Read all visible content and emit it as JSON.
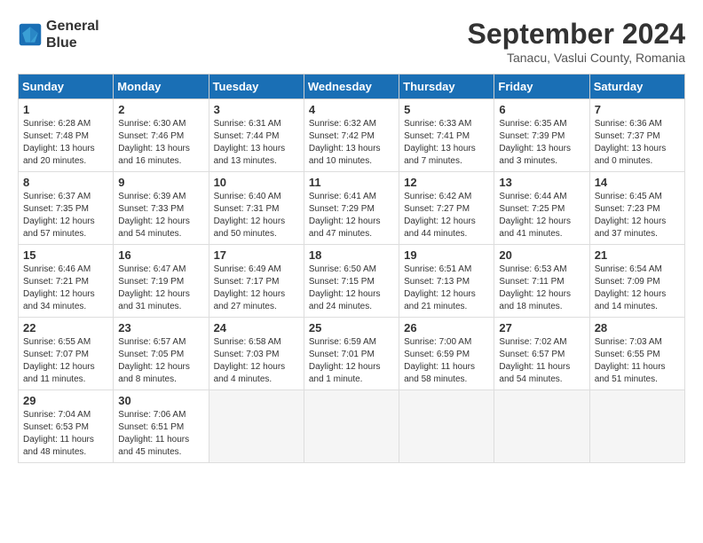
{
  "header": {
    "logo_line1": "General",
    "logo_line2": "Blue",
    "month": "September 2024",
    "location": "Tanacu, Vaslui County, Romania"
  },
  "weekdays": [
    "Sunday",
    "Monday",
    "Tuesday",
    "Wednesday",
    "Thursday",
    "Friday",
    "Saturday"
  ],
  "weeks": [
    [
      {
        "day": "1",
        "sunrise": "Sunrise: 6:28 AM",
        "sunset": "Sunset: 7:48 PM",
        "daylight": "Daylight: 13 hours and 20 minutes."
      },
      {
        "day": "2",
        "sunrise": "Sunrise: 6:30 AM",
        "sunset": "Sunset: 7:46 PM",
        "daylight": "Daylight: 13 hours and 16 minutes."
      },
      {
        "day": "3",
        "sunrise": "Sunrise: 6:31 AM",
        "sunset": "Sunset: 7:44 PM",
        "daylight": "Daylight: 13 hours and 13 minutes."
      },
      {
        "day": "4",
        "sunrise": "Sunrise: 6:32 AM",
        "sunset": "Sunset: 7:42 PM",
        "daylight": "Daylight: 13 hours and 10 minutes."
      },
      {
        "day": "5",
        "sunrise": "Sunrise: 6:33 AM",
        "sunset": "Sunset: 7:41 PM",
        "daylight": "Daylight: 13 hours and 7 minutes."
      },
      {
        "day": "6",
        "sunrise": "Sunrise: 6:35 AM",
        "sunset": "Sunset: 7:39 PM",
        "daylight": "Daylight: 13 hours and 3 minutes."
      },
      {
        "day": "7",
        "sunrise": "Sunrise: 6:36 AM",
        "sunset": "Sunset: 7:37 PM",
        "daylight": "Daylight: 13 hours and 0 minutes."
      }
    ],
    [
      {
        "day": "8",
        "sunrise": "Sunrise: 6:37 AM",
        "sunset": "Sunset: 7:35 PM",
        "daylight": "Daylight: 12 hours and 57 minutes."
      },
      {
        "day": "9",
        "sunrise": "Sunrise: 6:39 AM",
        "sunset": "Sunset: 7:33 PM",
        "daylight": "Daylight: 12 hours and 54 minutes."
      },
      {
        "day": "10",
        "sunrise": "Sunrise: 6:40 AM",
        "sunset": "Sunset: 7:31 PM",
        "daylight": "Daylight: 12 hours and 50 minutes."
      },
      {
        "day": "11",
        "sunrise": "Sunrise: 6:41 AM",
        "sunset": "Sunset: 7:29 PM",
        "daylight": "Daylight: 12 hours and 47 minutes."
      },
      {
        "day": "12",
        "sunrise": "Sunrise: 6:42 AM",
        "sunset": "Sunset: 7:27 PM",
        "daylight": "Daylight: 12 hours and 44 minutes."
      },
      {
        "day": "13",
        "sunrise": "Sunrise: 6:44 AM",
        "sunset": "Sunset: 7:25 PM",
        "daylight": "Daylight: 12 hours and 41 minutes."
      },
      {
        "day": "14",
        "sunrise": "Sunrise: 6:45 AM",
        "sunset": "Sunset: 7:23 PM",
        "daylight": "Daylight: 12 hours and 37 minutes."
      }
    ],
    [
      {
        "day": "15",
        "sunrise": "Sunrise: 6:46 AM",
        "sunset": "Sunset: 7:21 PM",
        "daylight": "Daylight: 12 hours and 34 minutes."
      },
      {
        "day": "16",
        "sunrise": "Sunrise: 6:47 AM",
        "sunset": "Sunset: 7:19 PM",
        "daylight": "Daylight: 12 hours and 31 minutes."
      },
      {
        "day": "17",
        "sunrise": "Sunrise: 6:49 AM",
        "sunset": "Sunset: 7:17 PM",
        "daylight": "Daylight: 12 hours and 27 minutes."
      },
      {
        "day": "18",
        "sunrise": "Sunrise: 6:50 AM",
        "sunset": "Sunset: 7:15 PM",
        "daylight": "Daylight: 12 hours and 24 minutes."
      },
      {
        "day": "19",
        "sunrise": "Sunrise: 6:51 AM",
        "sunset": "Sunset: 7:13 PM",
        "daylight": "Daylight: 12 hours and 21 minutes."
      },
      {
        "day": "20",
        "sunrise": "Sunrise: 6:53 AM",
        "sunset": "Sunset: 7:11 PM",
        "daylight": "Daylight: 12 hours and 18 minutes."
      },
      {
        "day": "21",
        "sunrise": "Sunrise: 6:54 AM",
        "sunset": "Sunset: 7:09 PM",
        "daylight": "Daylight: 12 hours and 14 minutes."
      }
    ],
    [
      {
        "day": "22",
        "sunrise": "Sunrise: 6:55 AM",
        "sunset": "Sunset: 7:07 PM",
        "daylight": "Daylight: 12 hours and 11 minutes."
      },
      {
        "day": "23",
        "sunrise": "Sunrise: 6:57 AM",
        "sunset": "Sunset: 7:05 PM",
        "daylight": "Daylight: 12 hours and 8 minutes."
      },
      {
        "day": "24",
        "sunrise": "Sunrise: 6:58 AM",
        "sunset": "Sunset: 7:03 PM",
        "daylight": "Daylight: 12 hours and 4 minutes."
      },
      {
        "day": "25",
        "sunrise": "Sunrise: 6:59 AM",
        "sunset": "Sunset: 7:01 PM",
        "daylight": "Daylight: 12 hours and 1 minute."
      },
      {
        "day": "26",
        "sunrise": "Sunrise: 7:00 AM",
        "sunset": "Sunset: 6:59 PM",
        "daylight": "Daylight: 11 hours and 58 minutes."
      },
      {
        "day": "27",
        "sunrise": "Sunrise: 7:02 AM",
        "sunset": "Sunset: 6:57 PM",
        "daylight": "Daylight: 11 hours and 54 minutes."
      },
      {
        "day": "28",
        "sunrise": "Sunrise: 7:03 AM",
        "sunset": "Sunset: 6:55 PM",
        "daylight": "Daylight: 11 hours and 51 minutes."
      }
    ],
    [
      {
        "day": "29",
        "sunrise": "Sunrise: 7:04 AM",
        "sunset": "Sunset: 6:53 PM",
        "daylight": "Daylight: 11 hours and 48 minutes."
      },
      {
        "day": "30",
        "sunrise": "Sunrise: 7:06 AM",
        "sunset": "Sunset: 6:51 PM",
        "daylight": "Daylight: 11 hours and 45 minutes."
      },
      null,
      null,
      null,
      null,
      null
    ]
  ]
}
